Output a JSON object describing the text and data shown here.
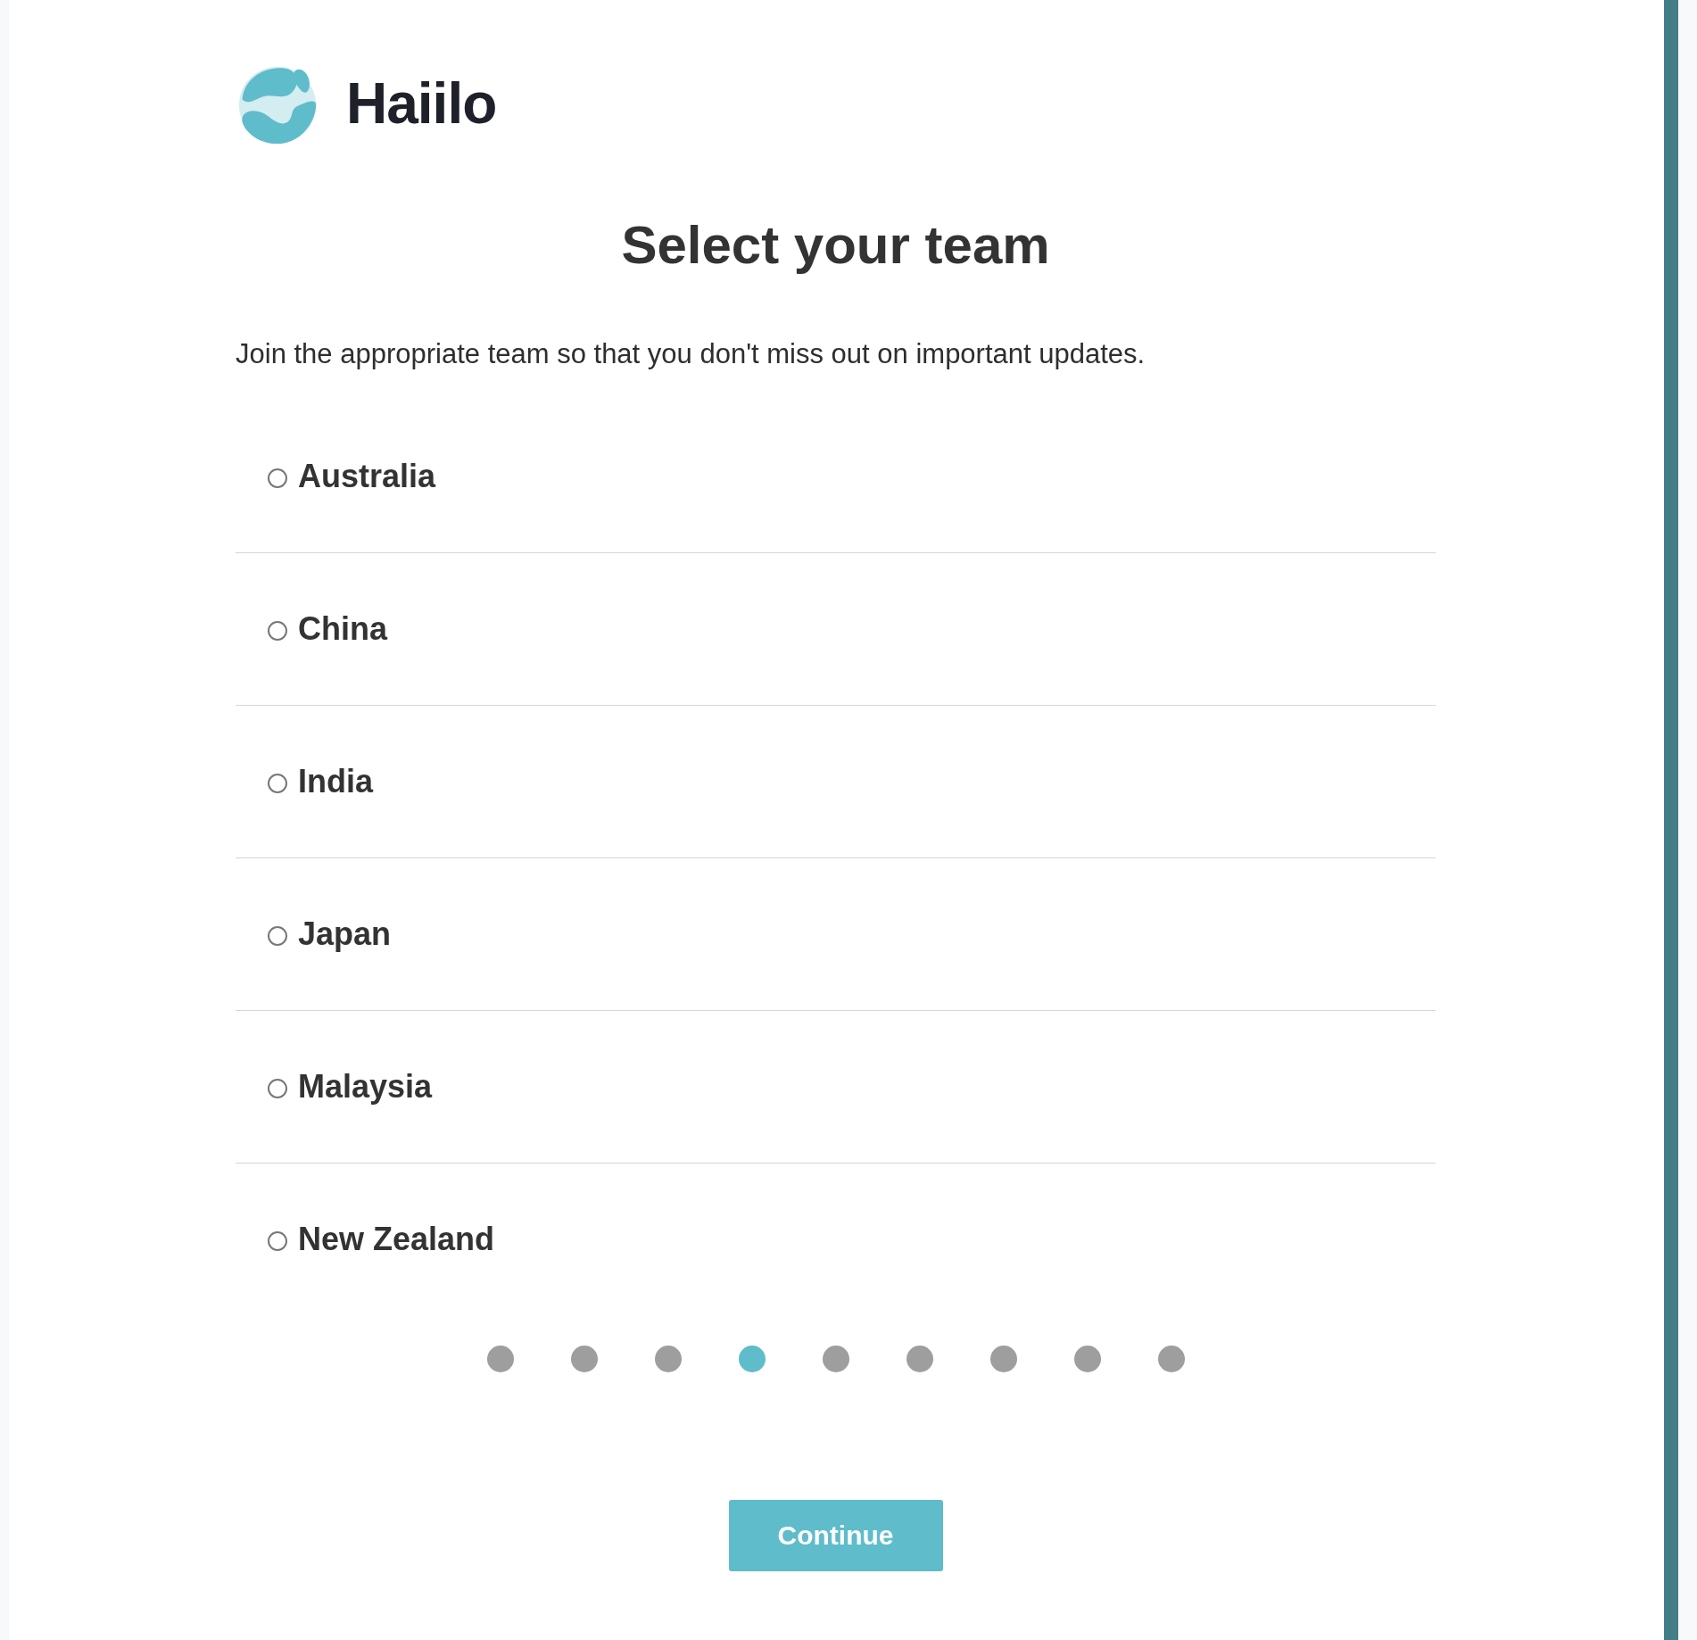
{
  "brand": {
    "name": "Haiilo"
  },
  "title": "Select your team",
  "subtitle": "Join the appropriate team so that you don't miss out on important updates.",
  "teams": [
    {
      "label": "Australia",
      "checked": false
    },
    {
      "label": "China",
      "checked": false
    },
    {
      "label": "India",
      "checked": false
    },
    {
      "label": "Japan",
      "checked": false
    },
    {
      "label": "Malaysia",
      "checked": false
    },
    {
      "label": "New Zealand",
      "checked": false
    }
  ],
  "steps": [
    {
      "selected": false
    },
    {
      "selected": false
    },
    {
      "selected": false
    },
    {
      "selected": true
    },
    {
      "selected": false
    },
    {
      "selected": false
    },
    {
      "selected": false
    },
    {
      "selected": false
    },
    {
      "selected": false
    }
  ],
  "continue_button": "Continue"
}
